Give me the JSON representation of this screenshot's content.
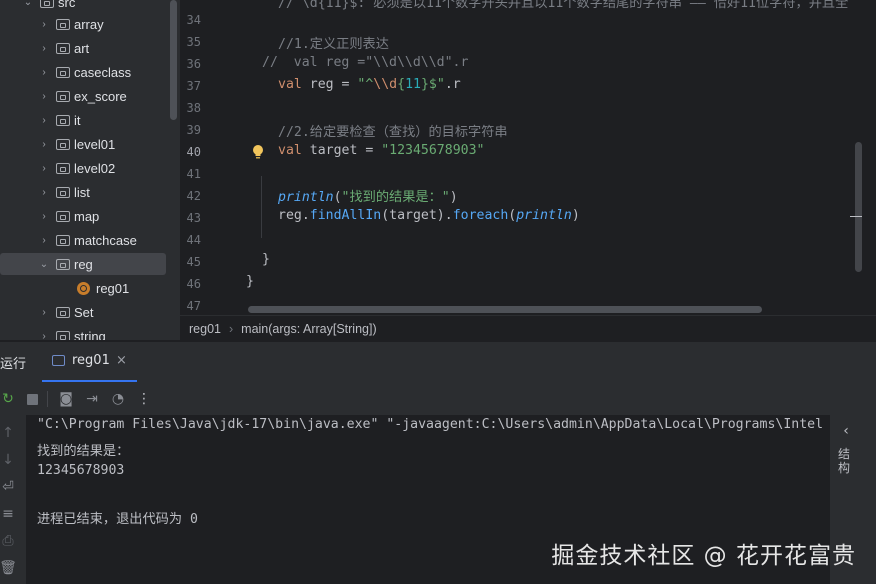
{
  "tree": {
    "items": [
      {
        "label": "src",
        "type": "folder",
        "expanded": true
      },
      {
        "label": "array",
        "type": "package",
        "expanded": false
      },
      {
        "label": "art",
        "type": "package",
        "expanded": false
      },
      {
        "label": "caseclass",
        "type": "package",
        "expanded": false
      },
      {
        "label": "ex_score",
        "type": "package",
        "expanded": false
      },
      {
        "label": "it",
        "type": "package",
        "expanded": false
      },
      {
        "label": "level01",
        "type": "package",
        "expanded": false
      },
      {
        "label": "level02",
        "type": "package",
        "expanded": false
      },
      {
        "label": "list",
        "type": "package",
        "expanded": false
      },
      {
        "label": "map",
        "type": "package",
        "expanded": false
      },
      {
        "label": "matchcase",
        "type": "package",
        "expanded": false
      },
      {
        "label": "reg",
        "type": "package",
        "expanded": true,
        "selected": true
      },
      {
        "label": "reg01",
        "type": "object"
      },
      {
        "label": "Set",
        "type": "package",
        "expanded": false
      },
      {
        "label": "string",
        "type": "package",
        "expanded": false
      }
    ]
  },
  "editor": {
    "line_numbers": [
      "34",
      "35",
      "36",
      "37",
      "38",
      "39",
      "40",
      "41",
      "42",
      "43",
      "44",
      "45",
      "46",
      "47"
    ],
    "current_line": "40",
    "lines": {
      "l34": "// \\d{11}$: 必须是以11个数字开头并且以11个数字结尾的字符串 —— 恰好11位字符，并且全",
      "l35": "//1.定义正则表达",
      "l36": "//  val reg =\"\\\\d\\\\d\\\\d\".r",
      "l37_kw": "val",
      "l37_name": " reg = ",
      "l37_str_a": "\"^",
      "l37_esc": "\\\\d",
      "l37_brace_a": "{",
      "l37_num": "11",
      "l37_brace_b": "}",
      "l37_str_b": "$\"",
      "l37_tail": ".r",
      "l39": "//2.给定要检查（查找）的目标字符串",
      "l40_kw": "val",
      "l40_name": " target = ",
      "l40_str": "\"12345678903\"",
      "l42_fn": "println",
      "l42_open": "(",
      "l42_str": "\"找到的结果是：\"",
      "l42_close": ")",
      "l43_a": "reg.",
      "l43_fn": "findAllIn",
      "l43_b": "(target).",
      "l43_fn2": "foreach",
      "l43_c": "(",
      "l43_fn3": "println",
      "l43_d": ")",
      "l45": "}",
      "l46": "}"
    }
  },
  "breadcrumb": {
    "object": "reg01",
    "method": "main(args: Array[String])",
    "separator": "›"
  },
  "run": {
    "title": "运行",
    "tab_label": "reg01",
    "console": [
      "\"C:\\Program Files\\Java\\jdk-17\\bin\\java.exe\" \"-javaagent:C:\\Users\\admin\\AppData\\Local\\Programs\\Intel",
      "找到的结果是：",
      "12345678903",
      "",
      "进程已结束，退出代码为 0"
    ],
    "side_label": "结构"
  },
  "watermark": "掘金技术社区 @ 花开花富贵"
}
